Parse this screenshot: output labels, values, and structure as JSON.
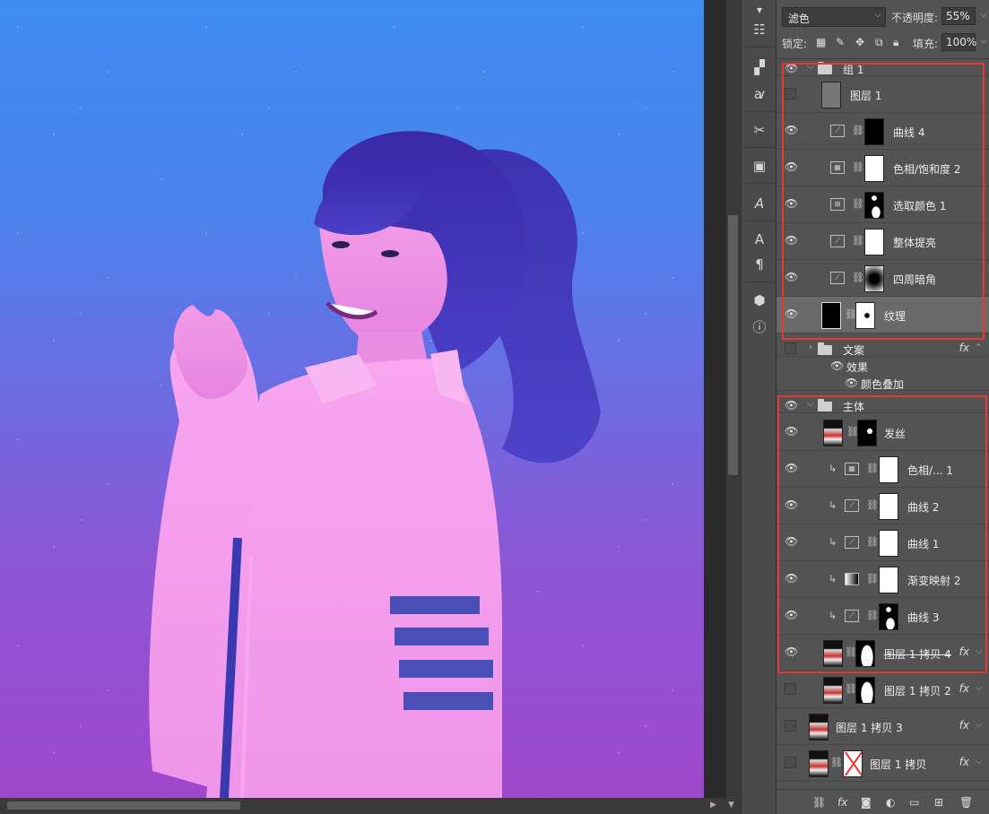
{
  "options": {
    "blend_mode": "滤色",
    "opacity_label": "不透明度:",
    "opacity_value": "55%",
    "lock_label": "锁定:",
    "fill_label": "填充:",
    "fill_value": "100%"
  },
  "layers": {
    "group1": "组 1",
    "layer1": "图层 1",
    "curve4": "曲线 4",
    "hue2": "色相/饱和度 2",
    "selcolor1": "选取颜色 1",
    "brighten": "整体提亮",
    "vignette": "四周暗角",
    "texture": "纹理",
    "wenan": "文案",
    "effect": "效果",
    "color_overlay": "颜色叠加",
    "zhuti": "主体",
    "hair": "发丝",
    "hue1": "色相/... 1",
    "curve2": "曲线 2",
    "curve1": "曲线 1",
    "gradmap2": "渐变映射 2",
    "curve3": "曲线 3",
    "copy4": "图层 1 拷贝 4",
    "copy2": "图层 1 拷贝 2",
    "copy3": "图层 1 拷贝 3",
    "copy": "图层 1 拷贝",
    "fx": "fx"
  },
  "colors": {
    "highlight_box": "#e53935",
    "bg_top": "#3f8cf0",
    "bg_bottom": "#9f48cc"
  }
}
